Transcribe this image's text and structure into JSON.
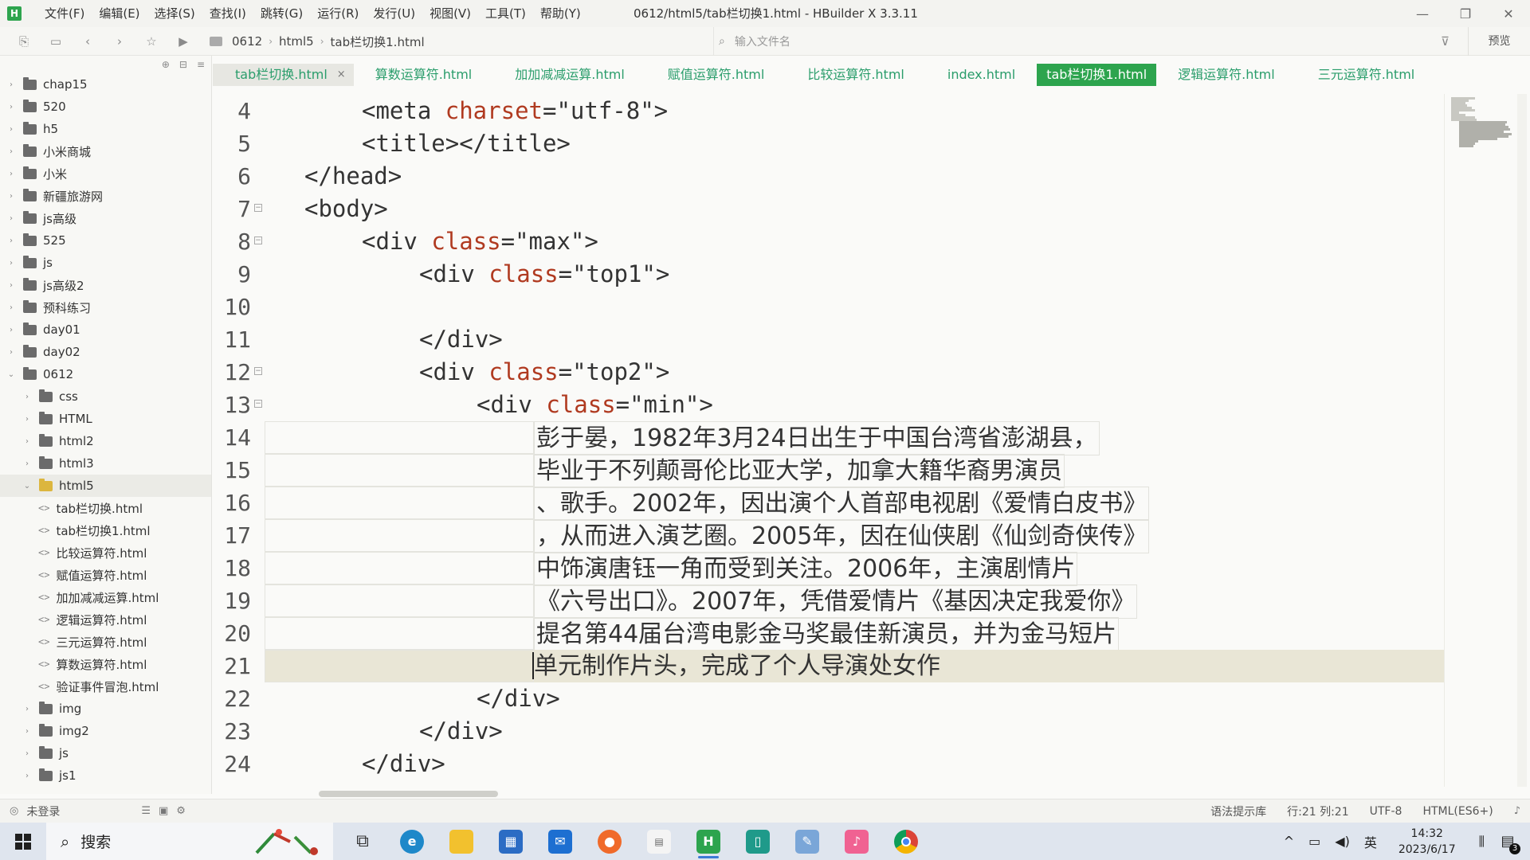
{
  "app": {
    "logo": "H",
    "window_title": "0612/html5/tab栏切换1.html - HBuilder X 3.3.11"
  },
  "menu": [
    "文件(F)",
    "编辑(E)",
    "选择(S)",
    "查找(I)",
    "跳转(G)",
    "运行(R)",
    "发行(U)",
    "视图(V)",
    "工具(T)",
    "帮助(Y)"
  ],
  "breadcrumb": [
    "0612",
    "html5",
    "tab栏切换1.html"
  ],
  "file_search": {
    "placeholder": "输入文件名"
  },
  "preview_label": "预览",
  "sidebar": {
    "items": [
      {
        "label": "chap15",
        "level": 0,
        "type": "folder",
        "expanded": false
      },
      {
        "label": "520",
        "level": 0,
        "type": "folder",
        "expanded": false
      },
      {
        "label": "h5",
        "level": 0,
        "type": "folder",
        "expanded": false
      },
      {
        "label": "小米商城",
        "level": 0,
        "type": "folder",
        "expanded": false
      },
      {
        "label": "小米",
        "level": 0,
        "type": "folder",
        "expanded": false
      },
      {
        "label": "新疆旅游网",
        "level": 0,
        "type": "folder",
        "expanded": false
      },
      {
        "label": "js高级",
        "level": 0,
        "type": "folder",
        "expanded": false
      },
      {
        "label": "525",
        "level": 0,
        "type": "folder",
        "expanded": false
      },
      {
        "label": "js",
        "level": 0,
        "type": "folder",
        "expanded": false
      },
      {
        "label": "js高级2",
        "level": 0,
        "type": "folder",
        "expanded": false
      },
      {
        "label": "预科练习",
        "level": 0,
        "type": "folder",
        "expanded": false
      },
      {
        "label": "day01",
        "level": 0,
        "type": "folder",
        "expanded": false
      },
      {
        "label": "day02",
        "level": 0,
        "type": "folder",
        "expanded": false
      },
      {
        "label": "0612",
        "level": 0,
        "type": "folder",
        "expanded": true
      },
      {
        "label": "css",
        "level": 1,
        "type": "folder",
        "expanded": false
      },
      {
        "label": "HTML",
        "level": 1,
        "type": "folder",
        "expanded": false
      },
      {
        "label": "html2",
        "level": 1,
        "type": "folder",
        "expanded": false
      },
      {
        "label": "html3",
        "level": 1,
        "type": "folder",
        "expanded": false
      },
      {
        "label": "html5",
        "level": 1,
        "type": "folder",
        "expanded": true,
        "selected": true
      },
      {
        "label": "tab栏切换.html",
        "level": 2,
        "type": "file"
      },
      {
        "label": "tab栏切换1.html",
        "level": 2,
        "type": "file"
      },
      {
        "label": "比较运算符.html",
        "level": 2,
        "type": "file"
      },
      {
        "label": "赋值运算符.html",
        "level": 2,
        "type": "file"
      },
      {
        "label": "加加减减运算.html",
        "level": 2,
        "type": "file"
      },
      {
        "label": "逻辑运算符.html",
        "level": 2,
        "type": "file"
      },
      {
        "label": "三元运算符.html",
        "level": 2,
        "type": "file"
      },
      {
        "label": "算数运算符.html",
        "level": 2,
        "type": "file"
      },
      {
        "label": "验证事件冒泡.html",
        "level": 2,
        "type": "file"
      },
      {
        "label": "img",
        "level": 1,
        "type": "folder",
        "expanded": false
      },
      {
        "label": "img2",
        "level": 1,
        "type": "folder",
        "expanded": false
      },
      {
        "label": "js",
        "level": 1,
        "type": "folder",
        "expanded": false
      },
      {
        "label": "js1",
        "level": 1,
        "type": "folder",
        "expanded": false
      }
    ]
  },
  "tabs": [
    {
      "label": "tab栏切换.html",
      "state": "hover",
      "close": "×"
    },
    {
      "label": "算数运算符.html"
    },
    {
      "label": "加加减减运算.html"
    },
    {
      "label": "赋值运算符.html"
    },
    {
      "label": "比较运算符.html"
    },
    {
      "label": "index.html"
    },
    {
      "label": "tab栏切换1.html",
      "state": "active"
    },
    {
      "label": "逻辑运算符.html"
    },
    {
      "label": "三元运算符.html"
    }
  ],
  "editor": {
    "lines": [
      {
        "n": "4",
        "indent": 2,
        "parts": [
          [
            "tag",
            "<meta "
          ],
          [
            "attr",
            "charset"
          ],
          [
            "tag",
            "="
          ],
          [
            "str",
            "\"utf-8\""
          ],
          [
            "tag",
            ">"
          ]
        ]
      },
      {
        "n": "5",
        "indent": 2,
        "parts": [
          [
            "tag",
            "<title></title>"
          ]
        ]
      },
      {
        "n": "6",
        "indent": 1,
        "parts": [
          [
            "tag",
            "</head>"
          ]
        ]
      },
      {
        "n": "7",
        "indent": 1,
        "fold": true,
        "parts": [
          [
            "tag",
            "<body>"
          ]
        ]
      },
      {
        "n": "8",
        "indent": 2,
        "fold": true,
        "parts": [
          [
            "tag",
            "<div "
          ],
          [
            "attr",
            "class"
          ],
          [
            "tag",
            "="
          ],
          [
            "str",
            "\"max\""
          ],
          [
            "tag",
            ">"
          ]
        ]
      },
      {
        "n": "9",
        "indent": 3,
        "parts": [
          [
            "tag",
            "<div "
          ],
          [
            "attr",
            "class"
          ],
          [
            "tag",
            "="
          ],
          [
            "str",
            "\"top1\""
          ],
          [
            "tag",
            ">"
          ]
        ]
      },
      {
        "n": "10",
        "indent": 3,
        "parts": []
      },
      {
        "n": "11",
        "indent": 3,
        "parts": [
          [
            "tag",
            "</div>"
          ]
        ]
      },
      {
        "n": "12",
        "indent": 3,
        "fold": true,
        "parts": [
          [
            "tag",
            "<div "
          ],
          [
            "attr",
            "class"
          ],
          [
            "tag",
            "="
          ],
          [
            "str",
            "\"top2\""
          ],
          [
            "tag",
            ">"
          ]
        ]
      },
      {
        "n": "13",
        "indent": 4,
        "fold": true,
        "parts": [
          [
            "tag",
            "<div "
          ],
          [
            "attr",
            "class"
          ],
          [
            "tag",
            "="
          ],
          [
            "str",
            "\"min\""
          ],
          [
            "tag",
            ">"
          ]
        ]
      },
      {
        "n": "14",
        "indent": 5,
        "cjk": true,
        "text": "彭于晏，1982年3月24日出生于中国台湾省澎湖县，"
      },
      {
        "n": "15",
        "indent": 5,
        "cjk": true,
        "text": "毕业于不列颠哥伦比亚大学，加拿大籍华裔男演员"
      },
      {
        "n": "16",
        "indent": 5,
        "cjk": true,
        "text": "、歌手。2002年，因出演个人首部电视剧《爱情白皮书》"
      },
      {
        "n": "17",
        "indent": 5,
        "cjk": true,
        "text": "，从而进入演艺圈。2005年，因在仙侠剧《仙剑奇侠传》"
      },
      {
        "n": "18",
        "indent": 5,
        "cjk": true,
        "text": "中饰演唐钰一角而受到关注。2006年，主演剧情片"
      },
      {
        "n": "19",
        "indent": 5,
        "cjk": true,
        "text": "《六号出口》。2007年，凭借爱情片《基因决定我爱你》"
      },
      {
        "n": "20",
        "indent": 5,
        "cjk": true,
        "text": "提名第44届台湾电影金马奖最佳新演员，并为金马短片"
      },
      {
        "n": "21",
        "indent": 5,
        "cjk": true,
        "current": true,
        "text": "单元制作片头，完成了个人导演处女作"
      },
      {
        "n": "22",
        "indent": 4,
        "parts": [
          [
            "tag",
            "</div>"
          ]
        ]
      },
      {
        "n": "23",
        "indent": 3,
        "parts": [
          [
            "tag",
            "</div>"
          ]
        ]
      },
      {
        "n": "24",
        "indent": 2,
        "parts": [
          [
            "tag",
            "</div>"
          ]
        ]
      }
    ]
  },
  "status": {
    "login": "未登录",
    "syntax_hint": "语法提示库",
    "position": "行:21  列:21",
    "encoding": "UTF-8",
    "language": "HTML(ES6+)"
  },
  "taskbar": {
    "search_label": "搜索",
    "ime": "英",
    "time": "14:32",
    "date": "2023/6/17",
    "notif_count": "3"
  },
  "colors": {
    "accent": "#2da44e",
    "tab_text": "#2a9d6b",
    "attr": "#b03a20",
    "current_line": "#e9e6d6"
  }
}
